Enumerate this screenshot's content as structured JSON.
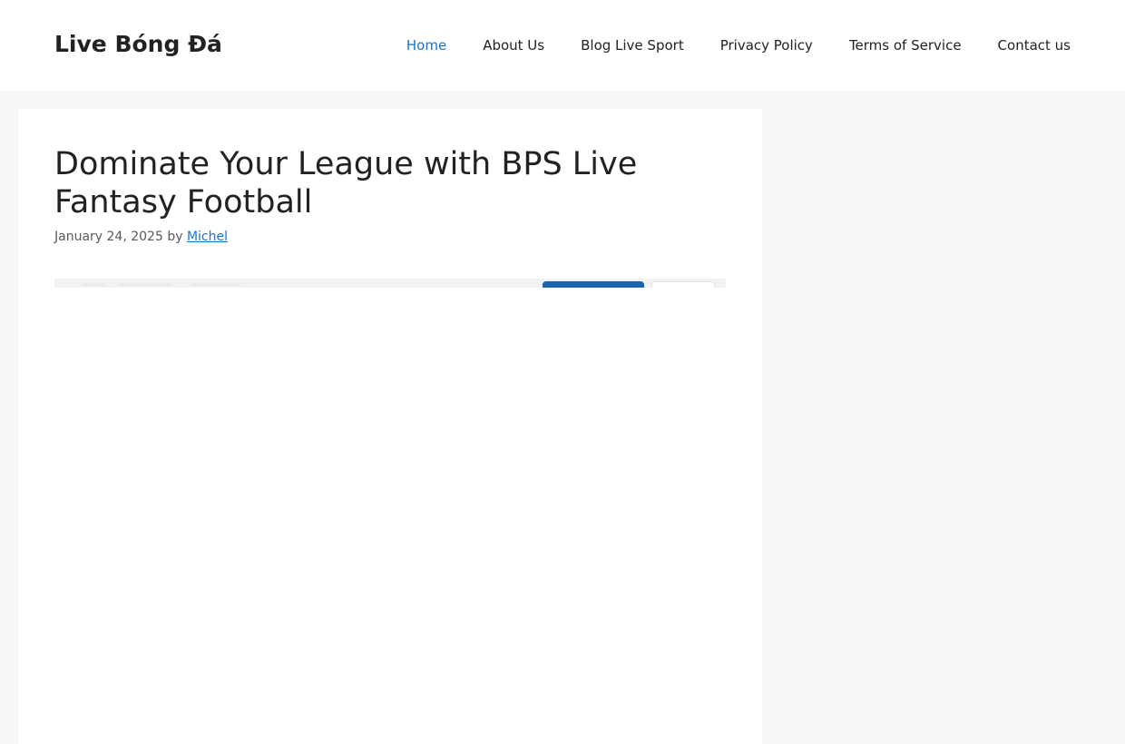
{
  "site": {
    "title": "Live Bóng Đá"
  },
  "nav": {
    "items": [
      {
        "label": "Home",
        "active": true
      },
      {
        "label": "About Us",
        "active": false
      },
      {
        "label": "Blog Live Sport",
        "active": false
      },
      {
        "label": "Privacy Policy",
        "active": false
      },
      {
        "label": "Terms of Service",
        "active": false
      },
      {
        "label": "Contact us",
        "active": false
      }
    ]
  },
  "post": {
    "title": "Dominate Your League with BPS Live Fantasy Football",
    "date": "January 24, 2025",
    "by": "by",
    "author": "Michel"
  },
  "colors": {
    "accent": "#1e73be",
    "page_background": "#f7f8f9",
    "text": "#222222",
    "meta_text": "#595959"
  }
}
